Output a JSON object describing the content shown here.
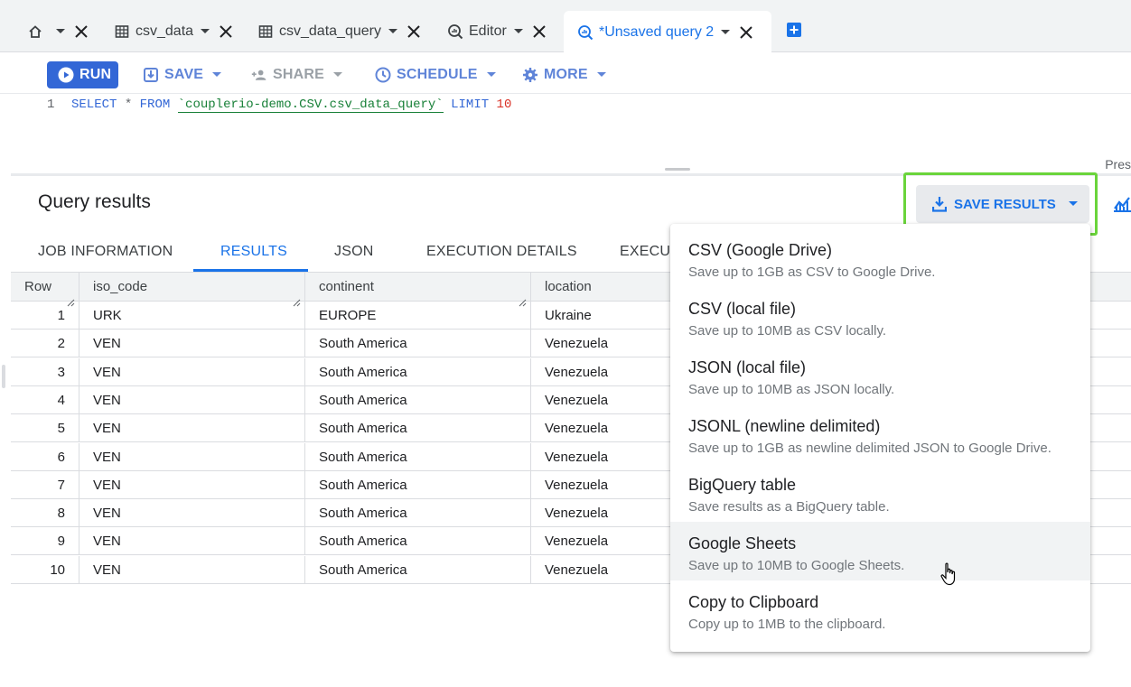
{
  "tabs": [
    {
      "label": "",
      "icon": "home-icon",
      "active": false
    },
    {
      "label": "csv_data",
      "icon": "table-icon",
      "active": false
    },
    {
      "label": "csv_data_query",
      "icon": "table-icon",
      "active": false
    },
    {
      "label": "Editor",
      "icon": "query-icon",
      "active": false
    },
    {
      "label": "*Unsaved query 2",
      "icon": "query-icon",
      "active": true
    }
  ],
  "toolbar": {
    "run": "RUN",
    "save": "SAVE",
    "share": "SHARE",
    "schedule": "SCHEDULE",
    "more": "MORE"
  },
  "editor": {
    "line_number": "1",
    "select": "SELECT",
    "star": "*",
    "from": "FROM",
    "table": "`couplerio-demo.CSV.csv_data_query`",
    "limit": "LIMIT",
    "limit_value": "10",
    "overflow_text": "Pres"
  },
  "results": {
    "title": "Query results",
    "save_results": "SAVE RESULTS",
    "tabs": [
      "JOB INFORMATION",
      "RESULTS",
      "JSON",
      "EXECUTION DETAILS",
      "EXECUT"
    ],
    "active_tab": "RESULTS",
    "columns": [
      "Row",
      "iso_code",
      "continent",
      "location"
    ],
    "rows": [
      [
        "1",
        "URK",
        "EUROPE",
        "Ukraine"
      ],
      [
        "2",
        "VEN",
        "South America",
        "Venezuela"
      ],
      [
        "3",
        "VEN",
        "South America",
        "Venezuela"
      ],
      [
        "4",
        "VEN",
        "South America",
        "Venezuela"
      ],
      [
        "5",
        "VEN",
        "South America",
        "Venezuela"
      ],
      [
        "6",
        "VEN",
        "South America",
        "Venezuela"
      ],
      [
        "7",
        "VEN",
        "South America",
        "Venezuela"
      ],
      [
        "8",
        "VEN",
        "South America",
        "Venezuela"
      ],
      [
        "9",
        "VEN",
        "South America",
        "Venezuela"
      ],
      [
        "10",
        "VEN",
        "South America",
        "Venezuela"
      ]
    ]
  },
  "save_menu": [
    {
      "title": "CSV (Google Drive)",
      "desc": "Save up to 1GB as CSV to Google Drive."
    },
    {
      "title": "CSV (local file)",
      "desc": "Save up to 10MB as CSV locally."
    },
    {
      "title": "JSON (local file)",
      "desc": "Save up to 10MB as JSON locally."
    },
    {
      "title": "JSONL (newline delimited)",
      "desc": "Save up to 1GB as newline delimited JSON to Google Drive."
    },
    {
      "title": "BigQuery table",
      "desc": "Save results as a BigQuery table."
    },
    {
      "title": "Google Sheets",
      "desc": "Save up to 10MB to Google Sheets.",
      "hovered": true
    },
    {
      "title": "Copy to Clipboard",
      "desc": "Copy up to 1MB to the clipboard."
    }
  ],
  "colors": {
    "accent": "#1a73e8",
    "run_button": "#3367d6",
    "highlight": "#6ad43b"
  }
}
